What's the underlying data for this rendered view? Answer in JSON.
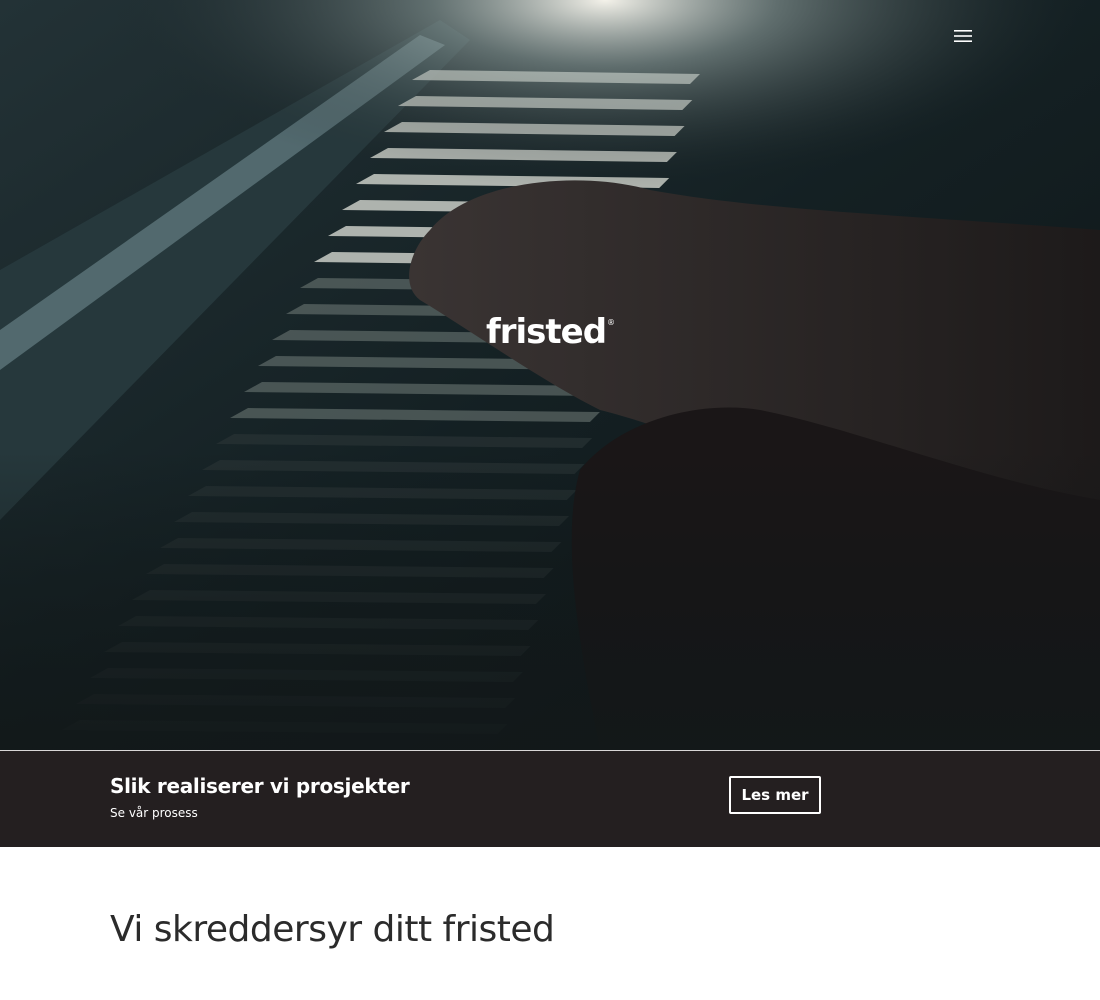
{
  "hero": {
    "image": "piano-keys-hands-photo",
    "logo": {
      "text": "fristed",
      "mark": "®"
    },
    "menu_icon": "hamburger-menu-icon"
  },
  "cta": {
    "title": "Slik realiserer vi prosjekter",
    "subtitle": "Se vår prosess",
    "button_label": "Les mer"
  },
  "main": {
    "heading": "Vi skreddersyr ditt fristed"
  },
  "colors": {
    "cta_background": "#241f20",
    "heading_text": "#2b2b2b",
    "white": "#ffffff"
  }
}
